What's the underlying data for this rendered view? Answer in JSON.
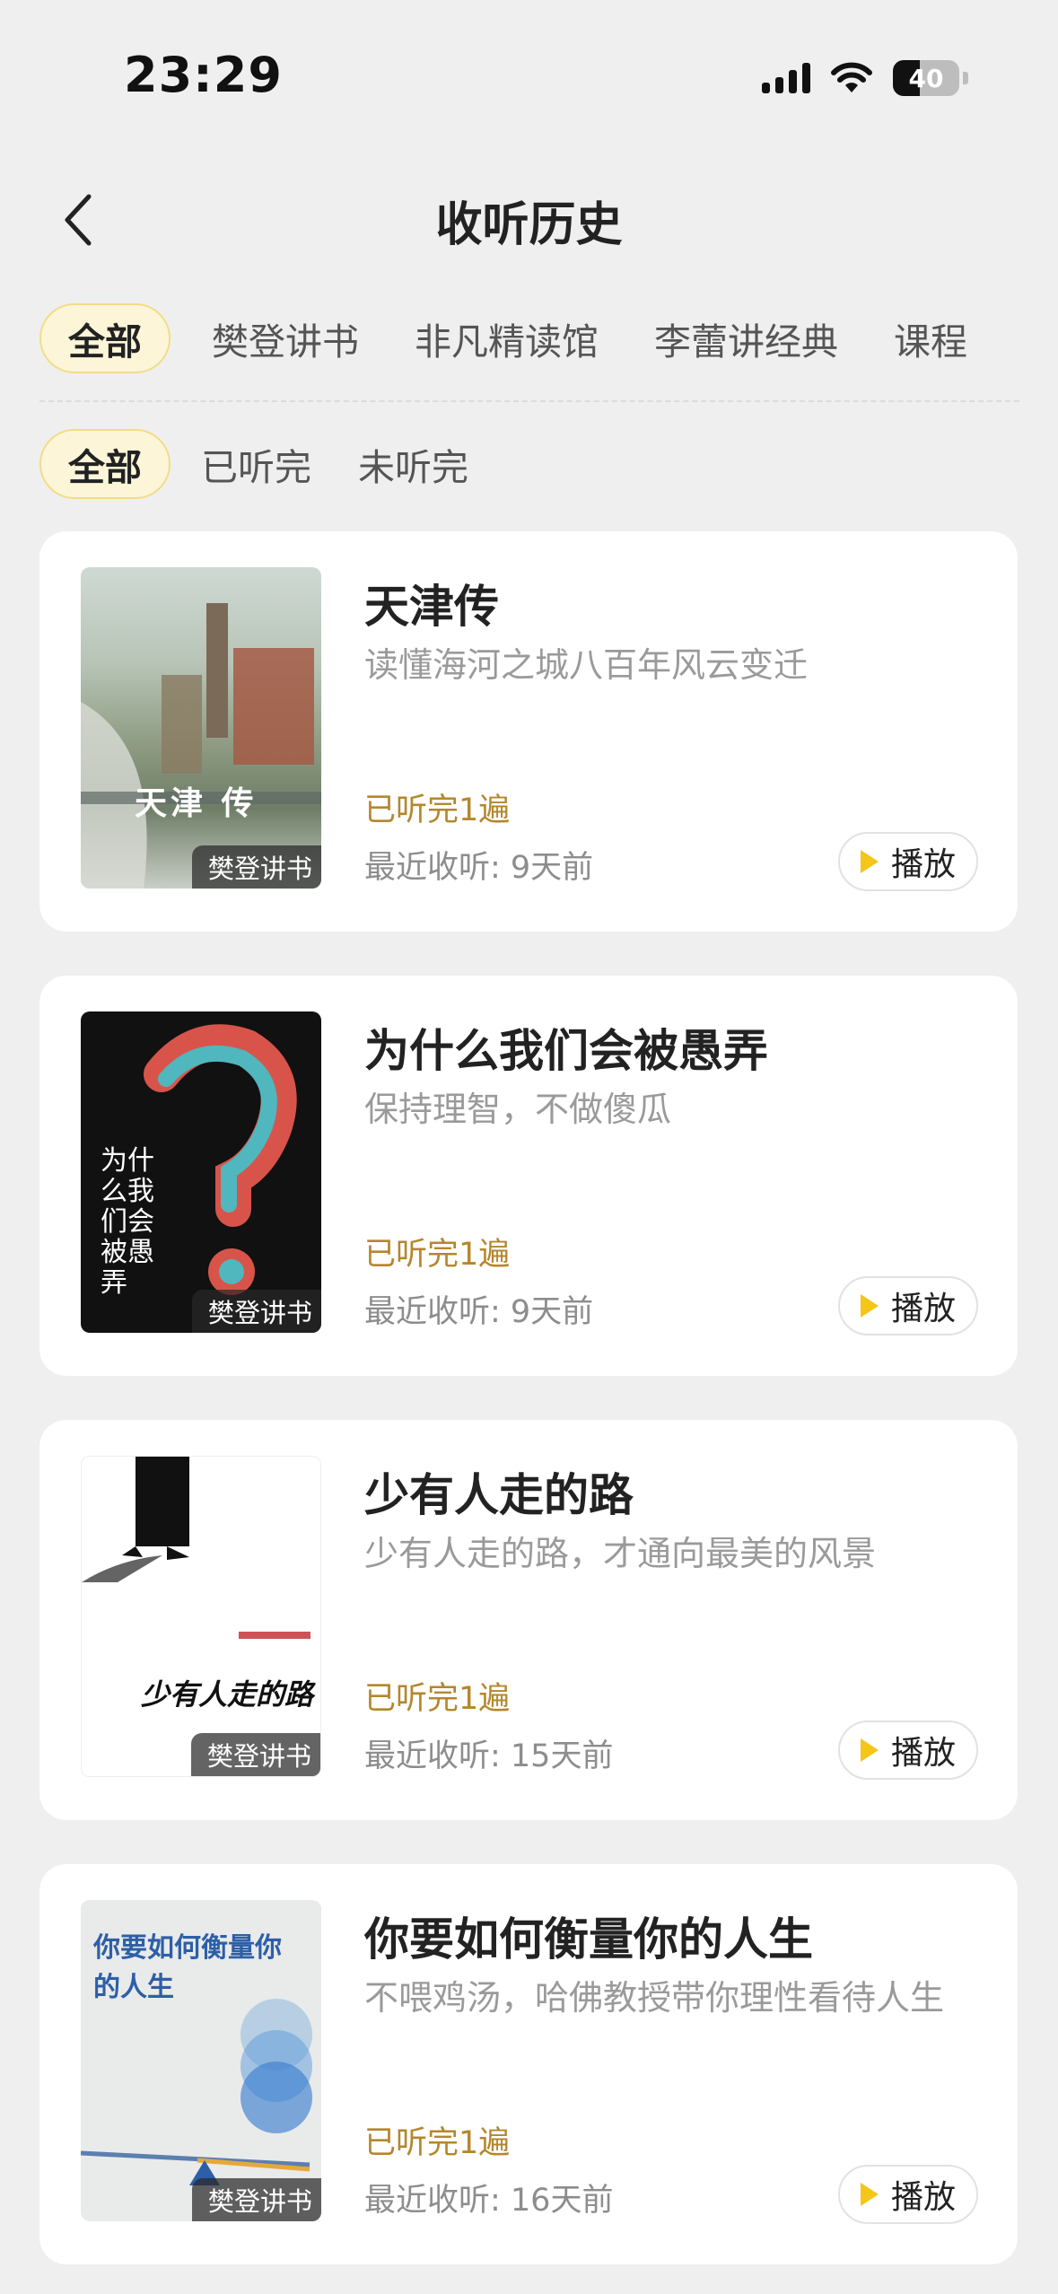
{
  "status": {
    "time": "23:29",
    "battery": "40"
  },
  "header": {
    "title": "收听历史"
  },
  "category_tabs": [
    {
      "label": "全部",
      "active": true
    },
    {
      "label": "樊登讲书",
      "active": false
    },
    {
      "label": "非凡精读馆",
      "active": false
    },
    {
      "label": "李蕾讲经典",
      "active": false
    },
    {
      "label": "课程",
      "active": false
    }
  ],
  "status_filters": [
    {
      "label": "全部",
      "active": true
    },
    {
      "label": "已听完",
      "active": false
    },
    {
      "label": "未听完",
      "active": false
    }
  ],
  "books": [
    {
      "title": "天津传",
      "subtitle": "读懂海河之城八百年风云变迁",
      "badge": "樊登讲书",
      "progress": "已听完1遍",
      "recent": "最近收听: 9天前",
      "play_label": "播放",
      "cover_text": "天津 传"
    },
    {
      "title": "为什么我们会被愚弄",
      "subtitle": "保持理智，不做傻瓜",
      "badge": "樊登讲书",
      "progress": "已听完1遍",
      "recent": "最近收听: 9天前",
      "play_label": "播放",
      "cover_text": "为什么我们会被愚弄"
    },
    {
      "title": "少有人走的路",
      "subtitle": "少有人走的路，才通向最美的风景",
      "badge": "樊登讲书",
      "progress": "已听完1遍",
      "recent": "最近收听: 15天前",
      "play_label": "播放",
      "cover_text": "少有人走的路"
    },
    {
      "title": "你要如何衡量你的人生",
      "subtitle": "不喂鸡汤，哈佛教授带你理性看待人生",
      "badge": "樊登讲书",
      "progress": "已听完1遍",
      "recent": "最近收听: 16天前",
      "play_label": "播放",
      "cover_text": "你要如何衡量你的人生"
    }
  ]
}
